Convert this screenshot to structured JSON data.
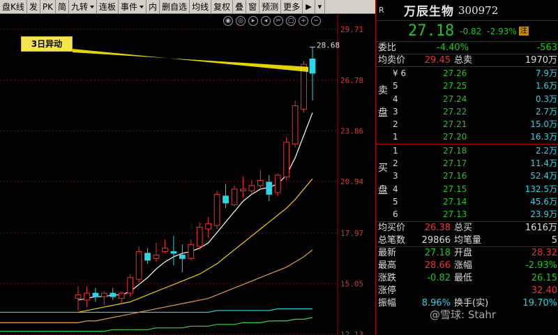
{
  "toolbar": {
    "items": [
      "盘K线",
      "发",
      "PK",
      "简",
      "九转",
      "连板",
      "事件",
      "内",
      "删自选",
      "均线",
      "复权",
      "叠",
      "窗",
      "预测",
      "更多"
    ],
    "dropdown_items": [
      "九转",
      "事件"
    ],
    "icons": [
      "pin-right-icon",
      "chevron-down-icon"
    ]
  },
  "chart": {
    "annotation": "3日异动",
    "last_high_label": "28.68",
    "price_ticks": [
      "29.71",
      "26.78",
      "23.86",
      "20.94",
      "17.97",
      "15.05",
      "12.13"
    ],
    "controls": [
      "eye-icon",
      "crosshair-icon",
      "play-icon",
      "prev-icon",
      "scissors-icon",
      "copy-icon",
      "zoom-in-icon",
      "zoom-out-icon"
    ],
    "colors": {
      "up": "#e33",
      "down": "#2ad7e6",
      "ma5": "#ffffff",
      "ma10": "#f0d000",
      "ma20": "#e0a040",
      "ma60": "#2ad7e6",
      "ma120": "#3ad44a",
      "anno_line": "#f0e000"
    }
  },
  "chart_data": {
    "type": "candlestick",
    "ylim": [
      12.13,
      29.71
    ],
    "candles": [
      [
        14.2,
        14.9,
        13.5,
        14.4
      ],
      [
        14.1,
        14.9,
        13.7,
        14.5
      ],
      [
        14.5,
        14.8,
        14.0,
        14.3
      ],
      [
        14.3,
        14.6,
        13.8,
        14.5
      ],
      [
        14.5,
        14.8,
        14.1,
        14.3
      ],
      [
        14.2,
        14.6,
        13.9,
        14.5
      ],
      [
        14.5,
        15.6,
        14.3,
        15.4
      ],
      [
        15.3,
        17.2,
        15.1,
        16.9
      ],
      [
        16.8,
        17.1,
        16.2,
        16.4
      ],
      [
        16.5,
        17.4,
        16.3,
        16.7
      ],
      [
        16.9,
        17.6,
        16.8,
        17.1
      ],
      [
        16.9,
        17.8,
        16.1,
        16.8
      ],
      [
        16.7,
        17.3,
        15.7,
        16.5
      ],
      [
        16.5,
        17.6,
        16.4,
        17.3
      ],
      [
        17.2,
        18.6,
        17.0,
        18.3
      ],
      [
        18.2,
        18.9,
        17.7,
        18.5
      ],
      [
        18.4,
        20.4,
        18.2,
        20.2
      ],
      [
        20.1,
        20.8,
        19.4,
        19.7
      ],
      [
        19.6,
        20.7,
        19.5,
        20.5
      ],
      [
        20.4,
        21.2,
        20.0,
        20.5
      ],
      [
        20.4,
        21.0,
        20.2,
        20.7
      ],
      [
        20.7,
        21.6,
        20.5,
        21.0
      ],
      [
        20.9,
        21.3,
        19.8,
        20.2
      ],
      [
        20.3,
        21.4,
        20.1,
        21.3
      ],
      [
        21.2,
        23.5,
        21.0,
        23.2
      ],
      [
        23.1,
        25.6,
        22.9,
        25.3
      ],
      [
        25.1,
        27.9,
        24.9,
        27.7
      ],
      [
        28.0,
        28.68,
        25.6,
        27.18
      ]
    ],
    "ma5": [
      14.1,
      14.2,
      14.3,
      14.3,
      14.4,
      14.4,
      14.6,
      15.0,
      15.4,
      15.9,
      16.3,
      16.6,
      16.8,
      16.9,
      17.1,
      17.4,
      18.0,
      18.6,
      19.2,
      19.8,
      20.2,
      20.5,
      20.6,
      20.8,
      21.3,
      22.3,
      23.6,
      24.9
    ],
    "ma10": [
      13.4,
      13.5,
      13.6,
      13.7,
      13.8,
      13.9,
      14.0,
      14.2,
      14.4,
      14.6,
      14.8,
      15.0,
      15.2,
      15.4,
      15.6,
      15.9,
      16.2,
      16.6,
      17.0,
      17.4,
      17.8,
      18.2,
      18.6,
      19.0,
      19.4,
      19.9,
      20.5,
      21.1
    ],
    "ma20": [
      12.8,
      12.9,
      12.9,
      13.0,
      13.1,
      13.2,
      13.3,
      13.4,
      13.5,
      13.6,
      13.7,
      13.8,
      13.9,
      14.0,
      14.1,
      14.2,
      14.4,
      14.6,
      14.8,
      15.0,
      15.2,
      15.4,
      15.6,
      15.8,
      16.0,
      16.3,
      16.6,
      17.0
    ],
    "ma60": [
      13.4,
      13.4,
      13.4,
      13.4,
      13.4,
      13.4,
      13.4,
      13.4,
      13.4,
      13.4,
      13.4,
      13.4,
      13.4,
      13.4,
      13.4,
      13.4,
      13.5,
      13.5,
      13.5,
      13.5,
      13.5,
      13.5,
      13.5,
      13.6,
      13.6,
      13.6,
      13.6,
      13.6
    ],
    "ma120": [
      12.3,
      12.3,
      12.3,
      12.3,
      12.4,
      12.4,
      12.4,
      12.4,
      12.4,
      12.5,
      12.5,
      12.5,
      12.5,
      12.6,
      12.6,
      12.6,
      12.7,
      12.7,
      12.7,
      12.8,
      12.8,
      12.8,
      12.9,
      12.9,
      12.9,
      13.0,
      13.0,
      13.1
    ]
  },
  "quote": {
    "r_tag": "R",
    "name": "万辰生物",
    "code": "300972",
    "last": "27.18",
    "change": "-0.82",
    "change_pct": "-2.93%",
    "badge": "注",
    "weibi_label": "委比",
    "weibi": "-4.40%",
    "weicha": "-563",
    "ask_avg_label": "均卖价",
    "ask_avg": "29.45",
    "ask_total_label": "总卖",
    "ask_total": "1970万",
    "sell_side": [
      "卖",
      "盘"
    ],
    "buy_side": [
      "买",
      "盘"
    ],
    "sells": [
      {
        "k": "¥ 6",
        "p": "27.26",
        "q": "7.9万"
      },
      {
        "k": "5",
        "p": "27.25",
        "q": "1.6万"
      },
      {
        "k": "4",
        "p": "27.24",
        "q": "0.3万"
      },
      {
        "k": "3",
        "p": "27.22",
        "q": "2.7万"
      },
      {
        "k": "2",
        "p": "27.21",
        "q": "15.0万"
      },
      {
        "k": "1",
        "p": "27.20",
        "q": "16.3万"
      }
    ],
    "buys": [
      {
        "k": "1",
        "p": "27.18",
        "q": "2.2万"
      },
      {
        "k": "2",
        "p": "27.17",
        "q": "11.4万"
      },
      {
        "k": "3",
        "p": "27.16",
        "q": "52.4万"
      },
      {
        "k": "4",
        "p": "27.15",
        "q": "132.5万"
      },
      {
        "k": "5",
        "p": "27.14",
        "q": "45.6万"
      },
      {
        "k": "6",
        "p": "27.13",
        "q": "23.9万"
      }
    ],
    "bid_avg_label": "均买价",
    "bid_avg": "26.38",
    "bid_total_label": "总买",
    "bid_total": "1616万",
    "trades_label": "总笔数",
    "trades": "29866",
    "avg_vol_label": "均笔量",
    "avg_vol": "5",
    "stats": [
      {
        "l1": "最新",
        "v1": "27.18",
        "c1": "g",
        "l2": "开盘",
        "v2": "28.32",
        "c2": "rd"
      },
      {
        "l1": "最高",
        "v1": "28.66",
        "c1": "rd",
        "l2": "涨幅",
        "v2": "-2.93%",
        "c2": "g"
      },
      {
        "l1": "涨跌",
        "v1": "-0.82",
        "c1": "g",
        "l2": "最低",
        "v2": "26.15",
        "c2": "g"
      },
      {
        "l1": "涨停",
        "v1": "",
        "c1": "rd",
        "l2": "",
        "v2": "32.40",
        "c2": "rd"
      },
      {
        "l1": "振幅",
        "v1": "8.96%",
        "c1": "c",
        "l2": "换手(实)",
        "v2": "19.70%",
        "c2": "c"
      }
    ]
  },
  "watermark": "@雪球: Stahr"
}
